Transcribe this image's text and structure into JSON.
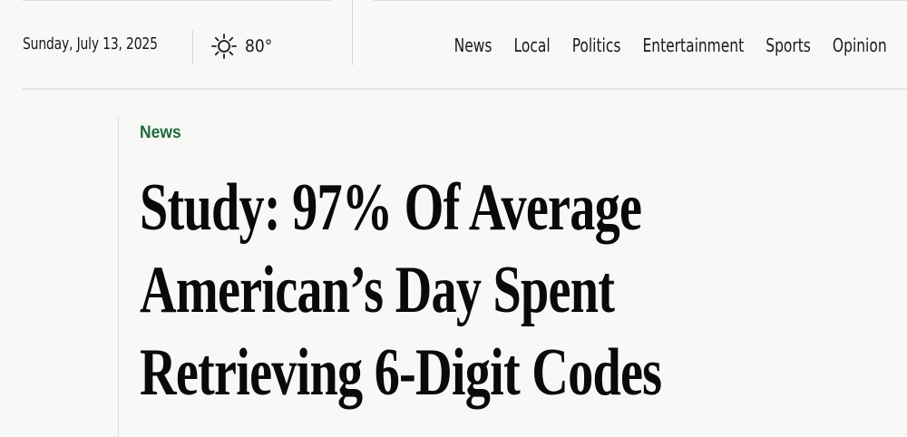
{
  "header": {
    "date": "Sunday, July 13, 2025",
    "weather": {
      "icon": "sun-icon",
      "temperature": "80°"
    }
  },
  "nav": {
    "items": [
      {
        "label": "News"
      },
      {
        "label": "Local"
      },
      {
        "label": "Politics"
      },
      {
        "label": "Entertainment"
      },
      {
        "label": "Sports"
      },
      {
        "label": "Opinion"
      }
    ]
  },
  "article": {
    "section": "News",
    "section_color": "#1f6b3a",
    "headline_lines": [
      "Study: 97% Of Average",
      "American’s Day Spent",
      "Retrieving 6-Digit Codes"
    ]
  }
}
